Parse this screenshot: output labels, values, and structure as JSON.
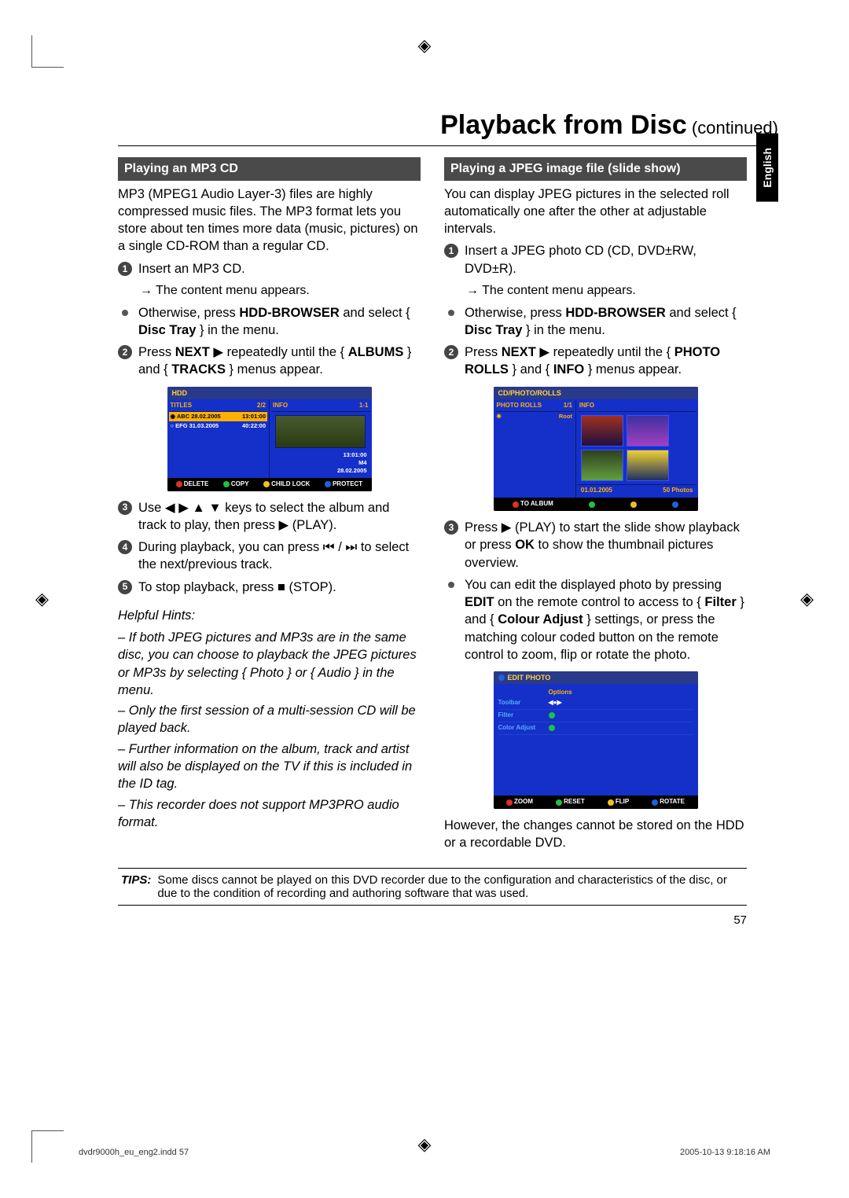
{
  "title": {
    "main": "Playback from Disc",
    "sub": " (continued)"
  },
  "lang_tab": "English",
  "left": {
    "header": "Playing an MP3 CD",
    "intro": "MP3 (MPEG1 Audio Layer-3) files are highly compressed music files.  The MP3 format lets you store about ten times more data (music, pictures) on a single CD-ROM than a regular CD.",
    "step1": "Insert an MP3 CD.",
    "step1_sub": "The content menu appears.",
    "bulletA_pre": "Otherwise, press ",
    "bulletA_b1": "HDD-BROWSER",
    "bulletA_mid": " and select { ",
    "bulletA_b2": "Disc Tray",
    "bulletA_post": " } in the menu.",
    "step2_pre": "Press ",
    "step2_b1": "NEXT",
    "step2_mid": " ▶  repeatedly until the { ",
    "step2_b2": "ALBUMS",
    "step2_mid2": " } and { ",
    "step2_b3": "TRACKS",
    "step2_post": " } menus appear.",
    "ss": {
      "hdr": "HDD",
      "col1_hdr": "TITLES",
      "col1_count": "2/2",
      "row1_a": "ABC 28.02.2005",
      "row1_b": "13:01:00",
      "row2_a": "EFG 31.03.2005",
      "row2_b": "40:22:00",
      "col2_hdr": "INFO",
      "col2_count": "1-1",
      "info1": "13:01:00",
      "info2": "M4",
      "info3": "28.02.2005",
      "f1": "DELETE",
      "f2": "COPY",
      "f3": "CHILD LOCK",
      "f4": "PROTECT"
    },
    "step3": "Use ◀ ▶ ▲ ▼ keys to select the album and track to play, then press ▶ (PLAY).",
    "step4": "During playback, you can press ⏮ / ⏭ to select the next/previous track.",
    "step5": "To stop playback, press ■ (STOP).",
    "hints_title": "Helpful Hints:",
    "h1": "– If both JPEG pictures and MP3s are in the same disc, you can choose to playback the JPEG pictures or MP3s by selecting { Photo } or { Audio } in the menu.",
    "h2": "– Only the first session of a multi-session CD will be played back.",
    "h3": "– Further information on the album, track and artist will also be displayed on the TV if this is included in the ID tag.",
    "h4": "– This recorder does not support MP3PRO audio format."
  },
  "right": {
    "header": "Playing a JPEG image file (slide show)",
    "intro": "You can display JPEG pictures in the selected roll automatically one after the other at adjustable intervals.",
    "step1": "Insert a JPEG photo CD (CD, DVD±RW, DVD±R).",
    "step1_sub": "The content menu appears.",
    "bulletA_pre": "Otherwise, press ",
    "bulletA_b1": "HDD-BROWSER",
    "bulletA_mid": " and select { ",
    "bulletA_b2": "Disc Tray",
    "bulletA_post": " } in the menu.",
    "step2_pre": "Press ",
    "step2_b1": "NEXT",
    "step2_mid": " ▶  repeatedly until the { ",
    "step2_b2": "PHOTO ROLLS",
    "step2_mid2": " } and { ",
    "step2_b3": "INFO",
    "step2_post": " } menus appear.",
    "ss1": {
      "hdr": "CD/PHOTO/ROLLS",
      "col1_hdr": "PHOTO ROLLS",
      "col1_count": "1/1",
      "root": "Root",
      "col2_hdr": "INFO",
      "foot_date": "01.01.2005",
      "foot_count": "50 Photos",
      "f1": "TO ALBUM"
    },
    "step3_pre": "Press ▶ (PLAY) to start the slide show playback or press ",
    "step3_b1": "OK",
    "step3_post": " to show the thumbnail pictures overview.",
    "bulletB_pre": "You can edit the displayed photo by pressing ",
    "bulletB_b1": "EDIT",
    "bulletB_mid": " on the remote control to access to { ",
    "bulletB_b2": "Filter",
    "bulletB_mid2": " } and { ",
    "bulletB_b3": "Colour Adjust",
    "bulletB_post": " } settings, or press the matching colour coded button on the remote control to zoom, flip or rotate the photo.",
    "ss2": {
      "hdr": "EDIT PHOTO",
      "opt": "Options",
      "r1": "Toolbar",
      "r2": "Filter",
      "r3": "Color Adjust",
      "f1": "ZOOM",
      "f2": "RESET",
      "f3": "FLIP",
      "f4": "ROTATE"
    },
    "outro": "However, the changes cannot be stored on the HDD or a recordable DVD."
  },
  "tips": {
    "label": "TIPS:",
    "text": "Some discs cannot be played on this DVD recorder due to the configuration and characteristics of the disc, or due to the condition of recording and authoring software that was used."
  },
  "page_num": "57",
  "footer": {
    "left": "dvdr9000h_eu_eng2.indd   57",
    "right": "2005-10-13   9:18:16 AM"
  }
}
